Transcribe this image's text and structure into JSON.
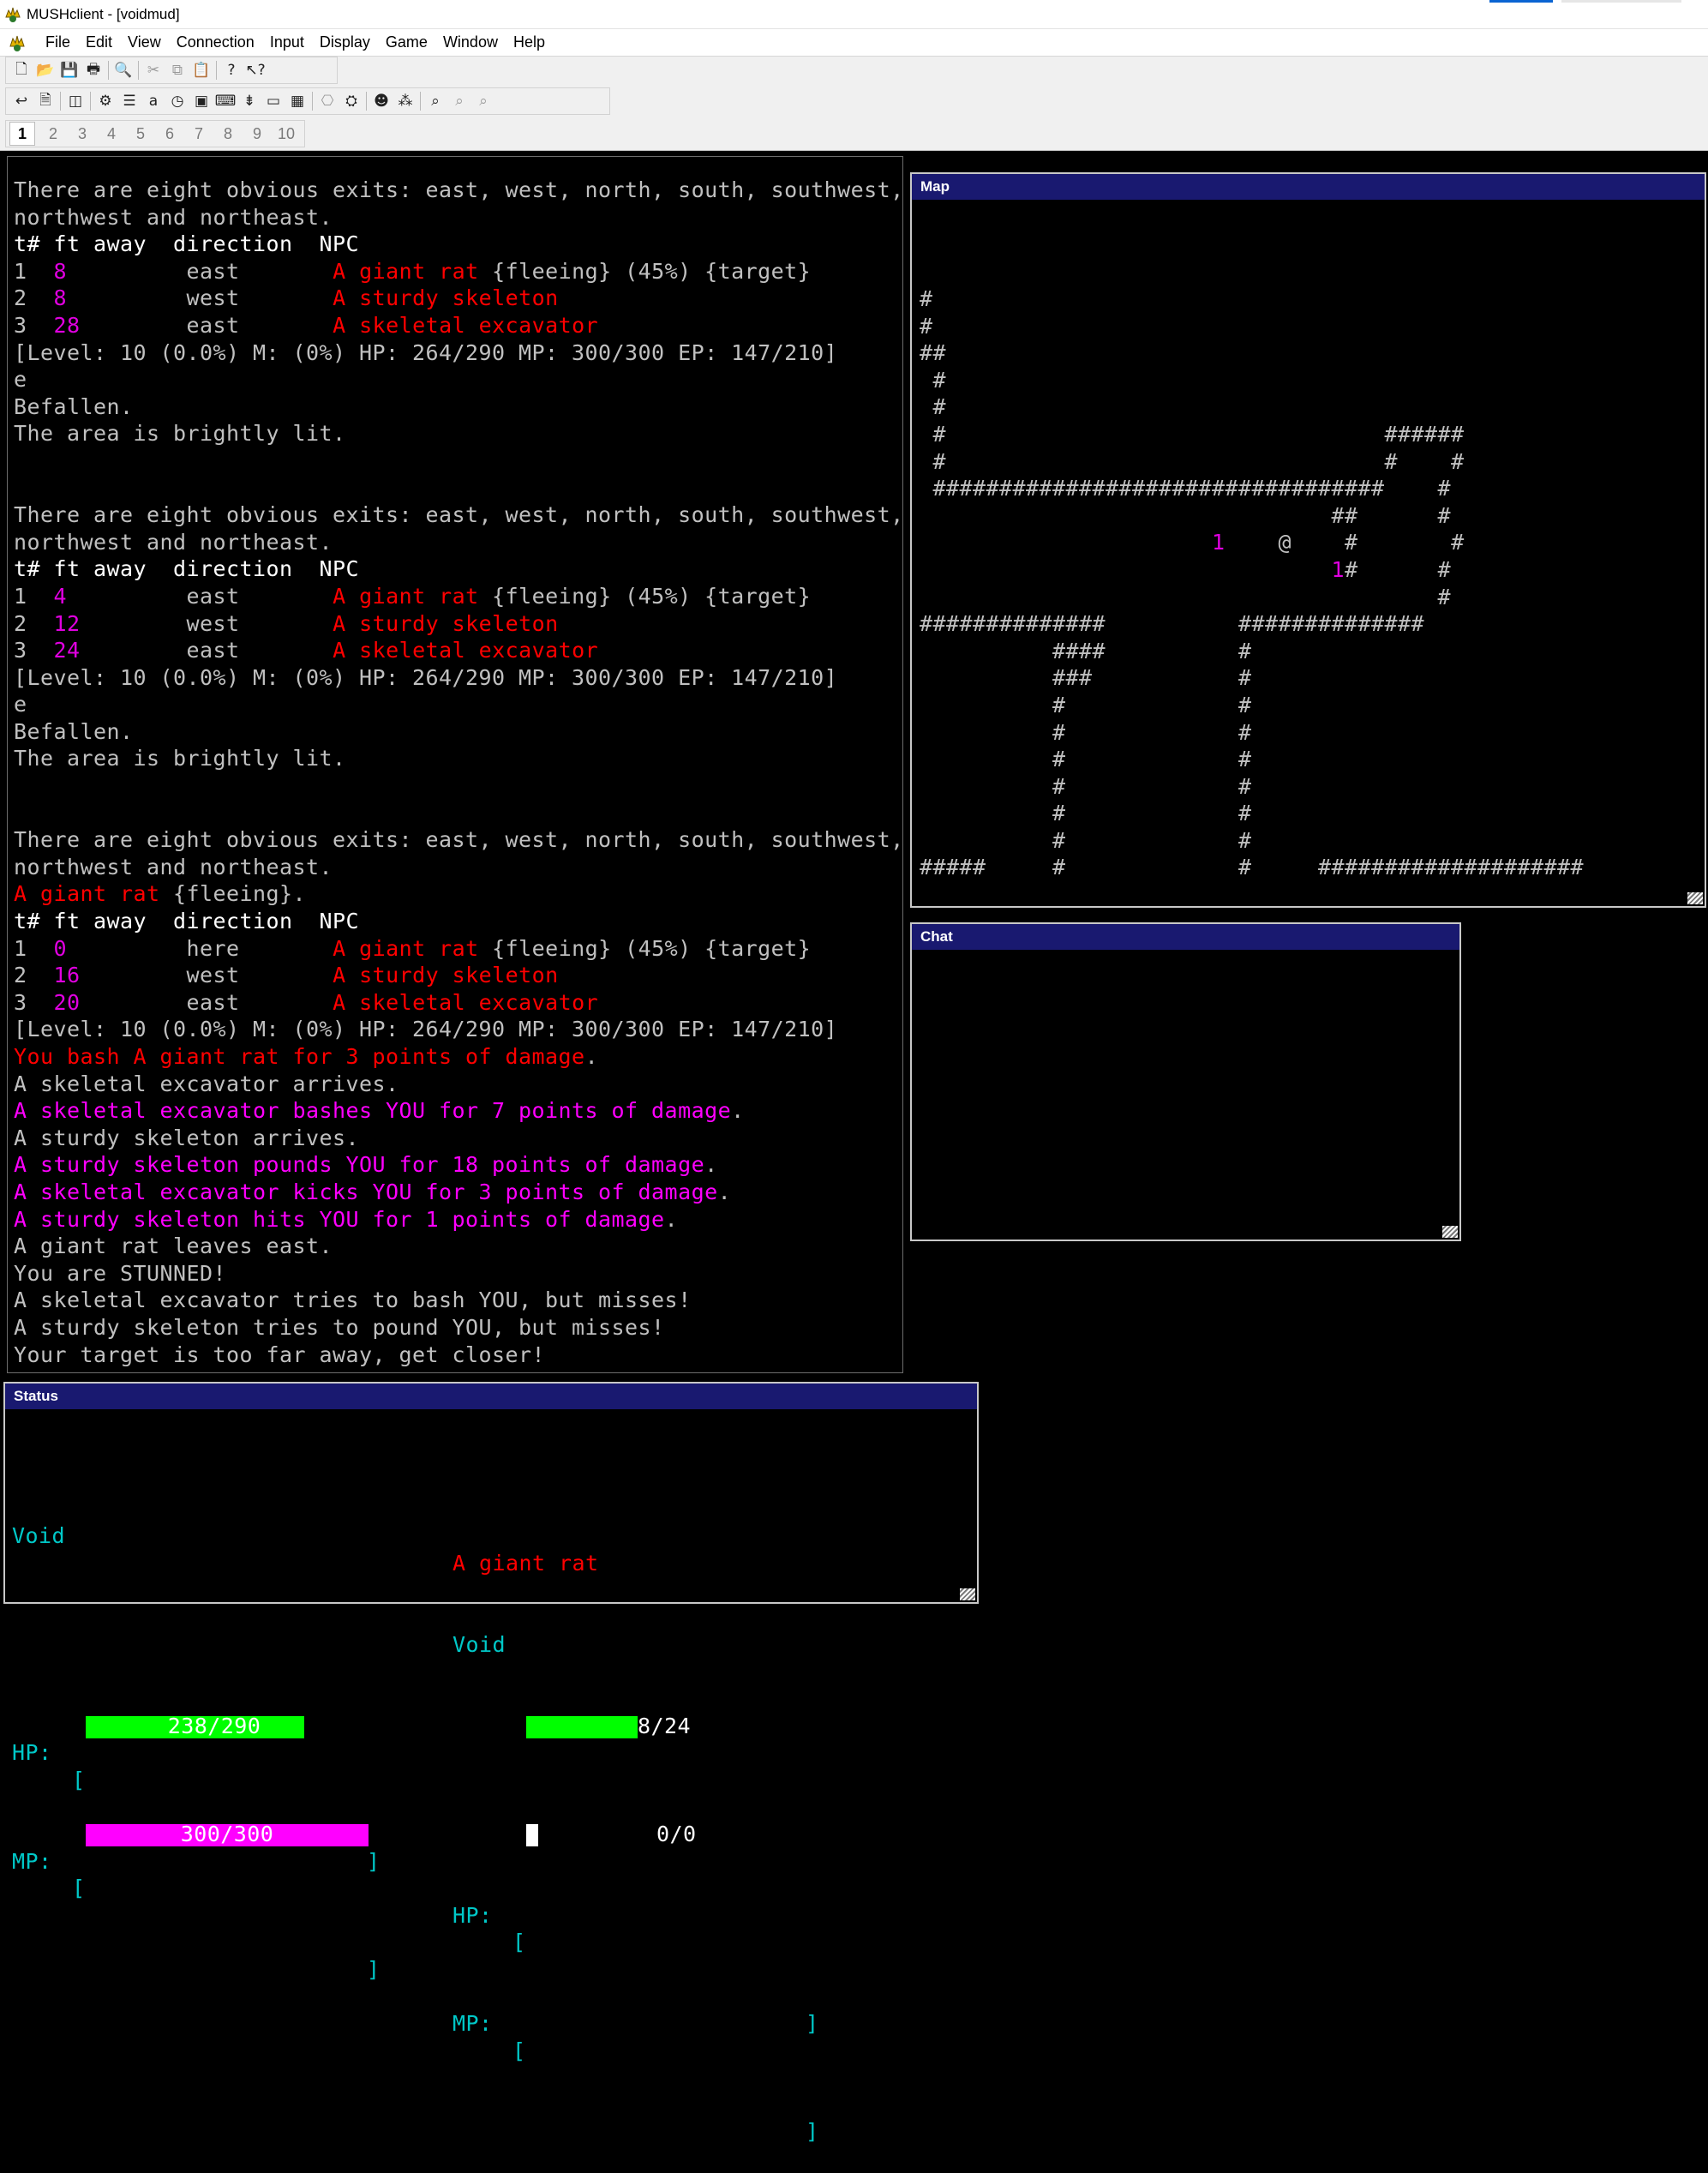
{
  "window": {
    "title": "MUSHclient - [voidmud]"
  },
  "menu": {
    "items": [
      "File",
      "Edit",
      "View",
      "Connection",
      "Input",
      "Display",
      "Game",
      "Window",
      "Help"
    ]
  },
  "toolbar": {
    "row1_icons": [
      "new-document-icon",
      "open-folder-icon",
      "save-icon",
      "print-icon",
      "print-preview-icon",
      "cut-icon",
      "copy-icon",
      "paste-icon",
      "help-icon",
      "context-help-icon"
    ],
    "row2_icons": [
      "reconnect-icon",
      "log-session-icon",
      "notes-icon",
      "world-properties-icon",
      "triggers-icon",
      "aliases-icon",
      "timers-icon",
      "output-colours-icon",
      "commands-icon",
      "macros-icon",
      "split-output-icon",
      "table-icon",
      "plugins-icon",
      "scripts-icon",
      "mapper-icon",
      "footprints-icon",
      "find-icon",
      "find-next-icon",
      "find-previous-icon"
    ]
  },
  "world_tabs": [
    "1",
    "2",
    "3",
    "4",
    "5",
    "6",
    "7",
    "8",
    "9",
    "10"
  ],
  "output": {
    "lines": [
      [
        [
          "w",
          "There are eight obvious exits: east, west, north, south, southwest,"
        ]
      ],
      [
        [
          "w",
          "northwest and northeast."
        ]
      ],
      [
        [
          "wb",
          "t# ft away  direction  NPC"
        ]
      ],
      [
        [
          "w",
          "1  "
        ],
        [
          "m",
          "8"
        ],
        [
          "w",
          "         east       "
        ],
        [
          "r",
          "A giant rat "
        ],
        [
          "w",
          "{fleeing} (45%) {target}"
        ]
      ],
      [
        [
          "w",
          "2  "
        ],
        [
          "m",
          "8"
        ],
        [
          "w",
          "         west       "
        ],
        [
          "r",
          "A sturdy skeleton"
        ]
      ],
      [
        [
          "w",
          "3  "
        ],
        [
          "m",
          "28"
        ],
        [
          "w",
          "        east       "
        ],
        [
          "r",
          "A skeletal excavator"
        ]
      ],
      [
        [
          "w",
          "[Level: 10 (0.0%) M: (0%) HP: 264/290 MP: 300/300 EP: 147/210]"
        ]
      ],
      [
        [
          "w",
          "e"
        ]
      ],
      [
        [
          "w",
          "Befallen."
        ]
      ],
      [
        [
          "w",
          "The area is brightly lit."
        ]
      ],
      [
        [
          "w",
          " "
        ]
      ],
      [
        [
          "w",
          " "
        ]
      ],
      [
        [
          "w",
          "There are eight obvious exits: east, west, north, south, southwest,"
        ]
      ],
      [
        [
          "w",
          "northwest and northeast."
        ]
      ],
      [
        [
          "wb",
          "t# ft away  direction  NPC"
        ]
      ],
      [
        [
          "w",
          "1  "
        ],
        [
          "m",
          "4"
        ],
        [
          "w",
          "         east       "
        ],
        [
          "r",
          "A giant rat "
        ],
        [
          "w",
          "{fleeing} (45%) {target}"
        ]
      ],
      [
        [
          "w",
          "2  "
        ],
        [
          "m",
          "12"
        ],
        [
          "w",
          "        west       "
        ],
        [
          "r",
          "A sturdy skeleton"
        ]
      ],
      [
        [
          "w",
          "3  "
        ],
        [
          "m",
          "24"
        ],
        [
          "w",
          "        east       "
        ],
        [
          "r",
          "A skeletal excavator"
        ]
      ],
      [
        [
          "w",
          "[Level: 10 (0.0%) M: (0%) HP: 264/290 MP: 300/300 EP: 147/210]"
        ]
      ],
      [
        [
          "w",
          "e"
        ]
      ],
      [
        [
          "w",
          "Befallen."
        ]
      ],
      [
        [
          "w",
          "The area is brightly lit."
        ]
      ],
      [
        [
          "w",
          " "
        ]
      ],
      [
        [
          "w",
          " "
        ]
      ],
      [
        [
          "w",
          "There are eight obvious exits: east, west, north, south, southwest,"
        ]
      ],
      [
        [
          "w",
          "northwest and northeast."
        ]
      ],
      [
        [
          "r",
          "A giant rat "
        ],
        [
          "w",
          "{fleeing}."
        ]
      ],
      [
        [
          "wb",
          "t# ft away  direction  NPC"
        ]
      ],
      [
        [
          "w",
          "1  "
        ],
        [
          "m",
          "0"
        ],
        [
          "w",
          "         here       "
        ],
        [
          "r",
          "A giant rat "
        ],
        [
          "w",
          "{fleeing} (45%) {target}"
        ]
      ],
      [
        [
          "w",
          "2  "
        ],
        [
          "m",
          "16"
        ],
        [
          "w",
          "        west       "
        ],
        [
          "r",
          "A sturdy skeleton"
        ]
      ],
      [
        [
          "w",
          "3  "
        ],
        [
          "m",
          "20"
        ],
        [
          "w",
          "        east       "
        ],
        [
          "r",
          "A skeletal excavator"
        ]
      ],
      [
        [
          "w",
          "[Level: 10 (0.0%) M: (0%) HP: 264/290 MP: 300/300 EP: 147/210]"
        ]
      ],
      [
        [
          "r",
          "You bash A giant rat for 3 points of damage"
        ],
        [
          "w",
          "."
        ]
      ],
      [
        [
          "w",
          "A skeletal excavator arrives."
        ]
      ],
      [
        [
          "mp",
          "A skeletal excavator bashes YOU for 7 points of damage"
        ],
        [
          "w",
          "."
        ]
      ],
      [
        [
          "w",
          "A sturdy skeleton arrives."
        ]
      ],
      [
        [
          "mp",
          "A sturdy skeleton pounds YOU for 18 points of damage"
        ],
        [
          "w",
          "."
        ]
      ],
      [
        [
          "mp",
          "A skeletal excavator kicks YOU for 3 points of damage"
        ],
        [
          "w",
          "."
        ]
      ],
      [
        [
          "mp",
          "A sturdy skeleton hits YOU for 1 points of damage"
        ],
        [
          "w",
          "."
        ]
      ],
      [
        [
          "w",
          "A giant rat leaves east."
        ]
      ],
      [
        [
          "w",
          "You are STUNNED!"
        ]
      ],
      [
        [
          "w",
          "A skeletal excavator tries to bash YOU, but misses!"
        ]
      ],
      [
        [
          "w",
          "A sturdy skeleton tries to pound YOU, but misses!"
        ]
      ],
      [
        [
          "w",
          "Your target is too far away, get closer!"
        ]
      ]
    ]
  },
  "map": {
    "title": "Map",
    "rows": [
      [
        [
          "w",
          "#"
        ]
      ],
      [
        [
          "w",
          "#"
        ]
      ],
      [
        [
          "w",
          "##"
        ]
      ],
      [
        [
          "w",
          " #"
        ]
      ],
      [
        [
          "w",
          " #"
        ]
      ],
      [
        [
          "w",
          " #                                 ######"
        ]
      ],
      [
        [
          "w",
          " #                                 #    #"
        ]
      ],
      [
        [
          "w",
          " ##################################    #"
        ]
      ],
      [
        [
          "w",
          "                               ##      #"
        ]
      ],
      [
        [
          "w",
          "                      "
        ],
        [
          "m",
          "1"
        ],
        [
          "w",
          "    @    #       #"
        ]
      ],
      [
        [
          "w",
          "                               "
        ],
        [
          "m",
          "1"
        ],
        [
          "w",
          "#      #"
        ]
      ],
      [
        [
          "w",
          "                                       #"
        ]
      ],
      [
        [
          "w",
          "##############          ##############"
        ]
      ],
      [
        [
          "w",
          "          ####          #"
        ]
      ],
      [
        [
          "w",
          "          ###           #"
        ]
      ],
      [
        [
          "w",
          "          #             #"
        ]
      ],
      [
        [
          "w",
          "          #             #"
        ]
      ],
      [
        [
          "w",
          "          #             #"
        ]
      ],
      [
        [
          "w",
          "          #             #"
        ]
      ],
      [
        [
          "w",
          "          #             #"
        ]
      ],
      [
        [
          "w",
          "          #             #"
        ]
      ],
      [
        [
          "w",
          "#####     #             #     ####################"
        ]
      ]
    ]
  },
  "chat": {
    "title": "Chat"
  },
  "status": {
    "title": "Status",
    "player_name": "Void",
    "target_name": "A giant rat",
    "target_owner": "Void",
    "hp_label": "HP:",
    "mp_label": "MP:",
    "player_hp_text": "238/290",
    "player_hp_fraction": 0.821,
    "player_mp_text": "300/300",
    "player_mp_fraction": 1.0,
    "target_hp_text": "8/24",
    "target_hp_fraction": 0.333,
    "target_mp_text": "0/0",
    "target_mp_fraction": 0.0,
    "colors": {
      "hp_bar": "#00ff00",
      "mp_bar": "#ff00ff",
      "label": "#00c8c8",
      "target": "#ff0000"
    }
  }
}
